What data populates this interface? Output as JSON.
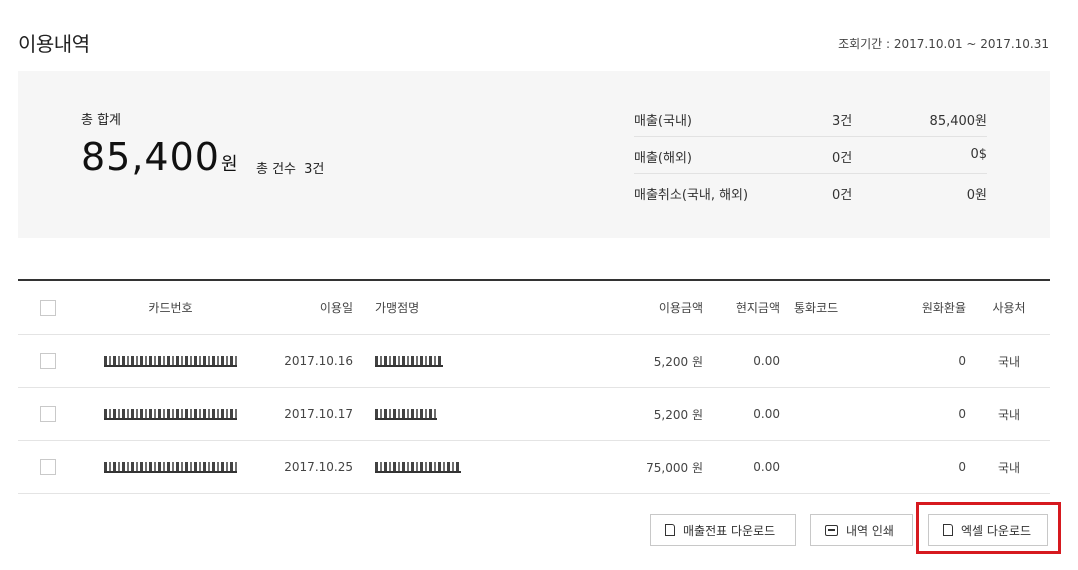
{
  "header": {
    "title": "이용내역",
    "period": "조회기간 : 2017.10.01 ~ 2017.10.31"
  },
  "summary": {
    "total_label": "총 합계",
    "total_amount": "85,400",
    "total_unit": "원",
    "count_label": "총 건수",
    "count_value": "3건",
    "breakdown": [
      {
        "label": "매출(국내)",
        "count": "3건",
        "amount": "85,400원"
      },
      {
        "label": "매출(해외)",
        "count": "0건",
        "amount": "0$"
      },
      {
        "label": "매출취소(국내, 해외)",
        "count": "0건",
        "amount": "0원"
      }
    ]
  },
  "table": {
    "columns": {
      "card": "카드번호",
      "date": "이용일",
      "merchant": "가맹점명",
      "amount": "이용금액",
      "local_amount": "현지금액",
      "currency": "통화코드",
      "rate": "원화환율",
      "usage": "사용처"
    },
    "rows": [
      {
        "date": "2017.10.16",
        "amount": "5,200 원",
        "local_amount": "0.00",
        "currency": "",
        "rate": "0",
        "usage": "국내"
      },
      {
        "date": "2017.10.17",
        "amount": "5,200 원",
        "local_amount": "0.00",
        "currency": "",
        "rate": "0",
        "usage": "국내"
      },
      {
        "date": "2017.10.25",
        "amount": "75,000 원",
        "local_amount": "0.00",
        "currency": "",
        "rate": "0",
        "usage": "국내"
      }
    ]
  },
  "actions": {
    "sales_slip_download": "매출전표 다운로드",
    "print_history": "내역 인쇄",
    "excel_download": "엑셀 다운로드"
  },
  "icons": {
    "sales_slip_download": "document-icon",
    "print_history": "printer-icon",
    "excel_download": "document-icon"
  },
  "colors": {
    "highlight": "#d6191f",
    "summary_bg": "#f6f6f6"
  }
}
